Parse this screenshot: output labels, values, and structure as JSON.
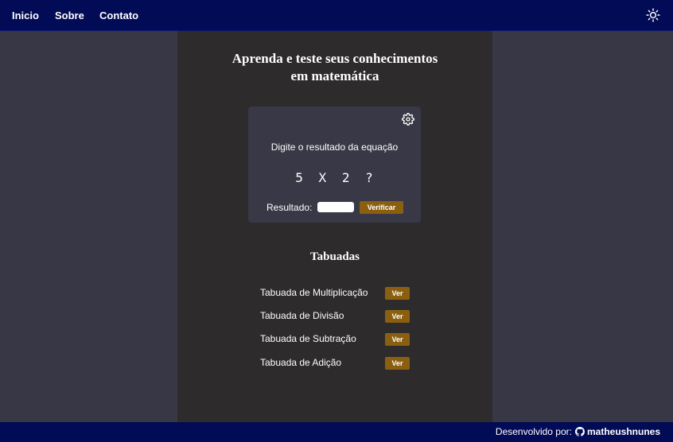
{
  "nav": {
    "links": [
      "Inicio",
      "Sobre",
      "Contato"
    ],
    "theme_icon": "sun-icon"
  },
  "hero": {
    "title_line1": "Aprenda e teste seus conhecimentos",
    "title_line2": "em matemática"
  },
  "quiz": {
    "settings_icon": "gear-icon",
    "prompt": "Digite o resultado da equação",
    "operand1": "5",
    "operator": "X",
    "operand2": "2",
    "unknown": "?",
    "result_label": "Resultado:",
    "result_value": "",
    "verify_label": "Verificar"
  },
  "tables": {
    "title": "Tabuadas",
    "items": [
      {
        "label": "Tabuada de Multiplicação",
        "button": "Ver"
      },
      {
        "label": "Tabuada de Divisão",
        "button": "Ver"
      },
      {
        "label": "Tabuada de Subtração",
        "button": "Ver"
      },
      {
        "label": "Tabuada de Adição",
        "button": "Ver"
      }
    ]
  },
  "footer": {
    "prefix": "Desenvolvido por:",
    "github_icon": "github-icon",
    "author": "matheushnunes"
  },
  "colors": {
    "navbar": "#020b55",
    "page_bg": "#383745",
    "main_bg": "#2d2b2c",
    "card_bg": "#393846",
    "button": "#8a6010"
  }
}
